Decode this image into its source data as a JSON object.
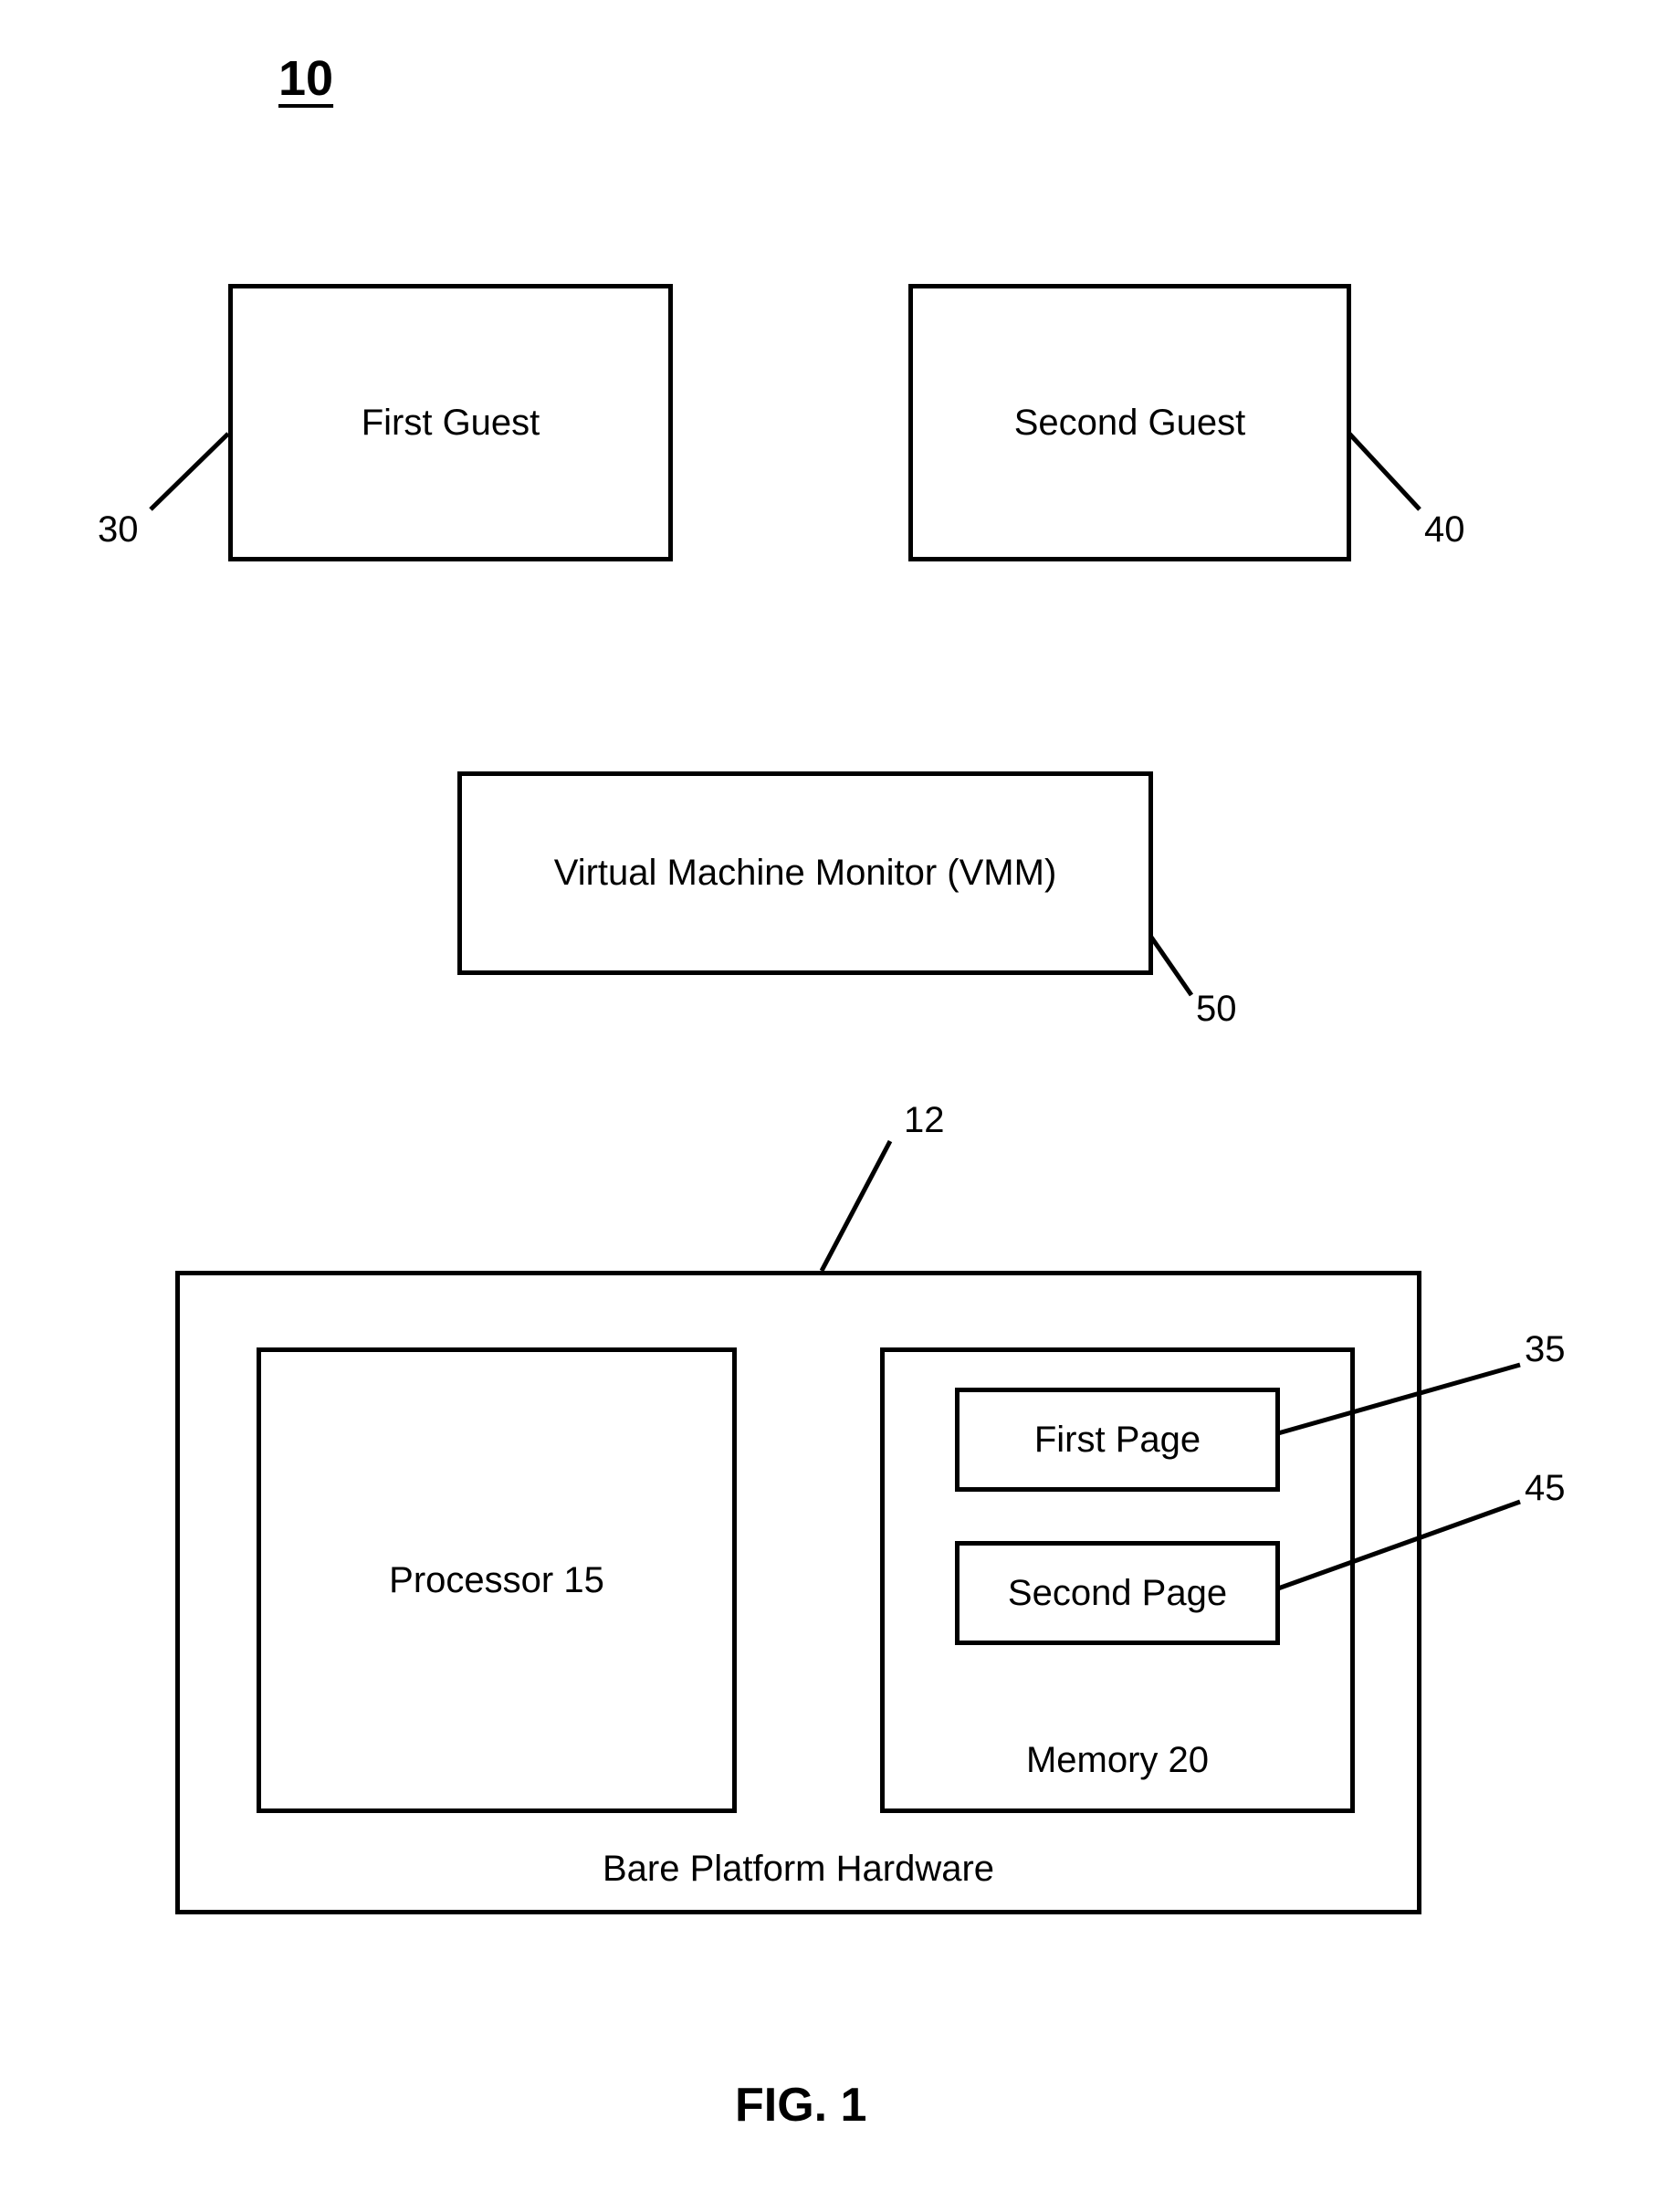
{
  "title_number": "10",
  "boxes": {
    "first_guest": "First Guest",
    "second_guest": "Second Guest",
    "vmm": "Virtual Machine Monitor (VMM)",
    "processor": "Processor 15",
    "first_page": "First Page",
    "second_page": "Second Page",
    "memory": "Memory 20",
    "bare_platform": "Bare Platform Hardware"
  },
  "callouts": {
    "first_guest_ref": "30",
    "second_guest_ref": "40",
    "vmm_ref": "50",
    "bare_platform_ref": "12",
    "first_page_ref": "35",
    "second_page_ref": "45"
  },
  "figure_label": "FIG. 1"
}
